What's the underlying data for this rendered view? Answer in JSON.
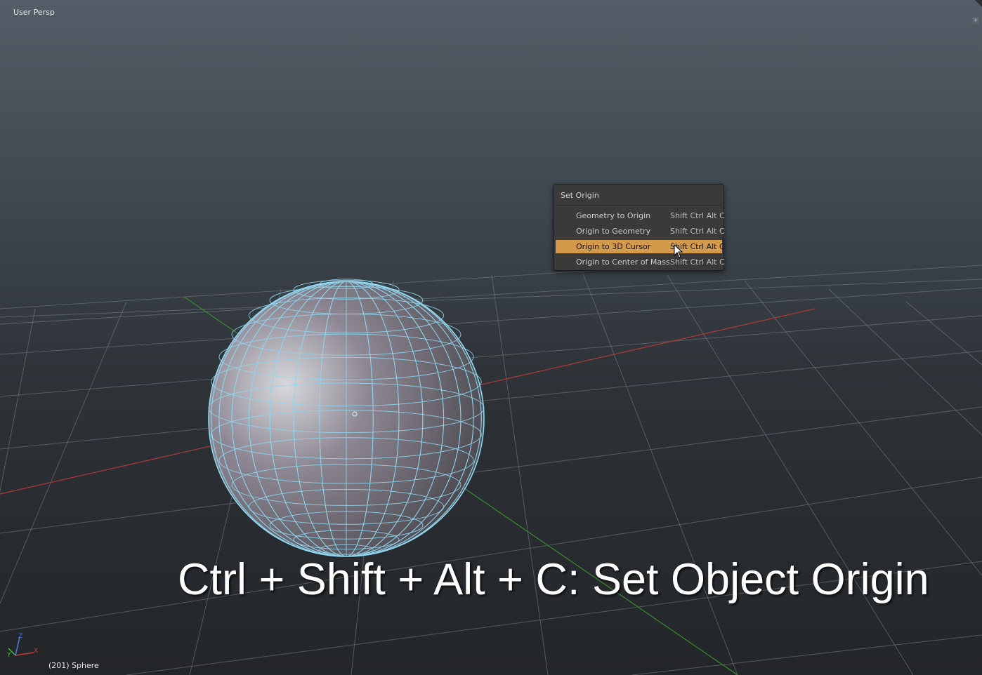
{
  "viewport": {
    "view_name": "User Persp",
    "object_info": "(201) Sphere",
    "grid_color": "#7a8188",
    "x_axis_color": "#b0393a",
    "y_axis_color": "#3a8a2e",
    "wire_color": "#8fd6ee"
  },
  "menu": {
    "title": "Set Origin",
    "items": [
      {
        "label": "Geometry to Origin",
        "shortcut": "Shift Ctrl Alt C",
        "active": false
      },
      {
        "label": "Origin to Geometry",
        "shortcut": "Shift Ctrl Alt C",
        "active": false
      },
      {
        "label": "Origin to 3D Cursor",
        "shortcut": "Shift Ctrl Alt C",
        "active": true
      },
      {
        "label": "Origin to Center of Mass",
        "shortcut": "Shift Ctrl Alt C",
        "active": false
      }
    ],
    "highlight_color": "#d49a4c"
  },
  "caption": "Ctrl + Shift + Alt + C: Set Object Origin",
  "gizmo": {
    "axes": [
      "X",
      "Y",
      "Z"
    ],
    "colors": {
      "x": "#d03a3a",
      "y": "#3fbf3f",
      "z": "#4a7de0"
    }
  }
}
